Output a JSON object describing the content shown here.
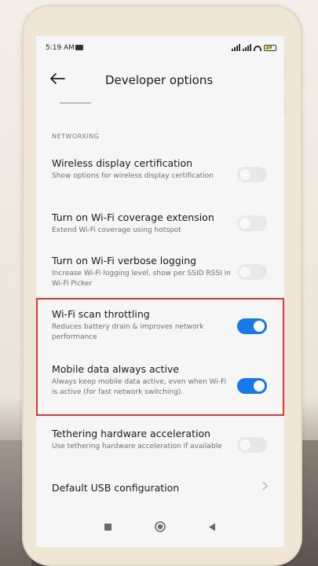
{
  "status_bar": {
    "time": "5:19 AM",
    "battery": "24"
  },
  "header": {
    "title": "Developer options"
  },
  "section": {
    "label": "NETWORKING"
  },
  "settings": [
    {
      "title": "Wireless display certification",
      "desc": "Show options for wireless display certification",
      "state": "off"
    },
    {
      "title": "Turn on Wi-Fi coverage extension",
      "desc": "Extend Wi-Fi coverage using hotspot",
      "state": "off"
    },
    {
      "title": "Turn on Wi-Fi verbose logging",
      "desc": "Increase Wi-Fi logging level, show per SSID RSSI in Wi-Fi Picker",
      "state": "off"
    },
    {
      "title": "Wi-Fi scan throttling",
      "desc": "Reduces battery drain & improves network performance",
      "state": "on"
    },
    {
      "title": "Mobile data always active",
      "desc": "Always keep mobile data active, even when Wi-Fi is active (for fast network switching).",
      "state": "on"
    },
    {
      "title": "Tethering hardware acceleration",
      "desc": "Use tethering hardware acceleration if available",
      "state": "off"
    },
    {
      "title": "Default USB configuration"
    }
  ],
  "colors": {
    "toggle_on": "#1779ea",
    "highlight": "#e23a2d"
  },
  "icons": {
    "back": "arrow-left-icon",
    "chevron": "chevron-right-icon",
    "nav": [
      "recents-square-icon",
      "home-circle-icon",
      "back-triangle-icon"
    ]
  }
}
